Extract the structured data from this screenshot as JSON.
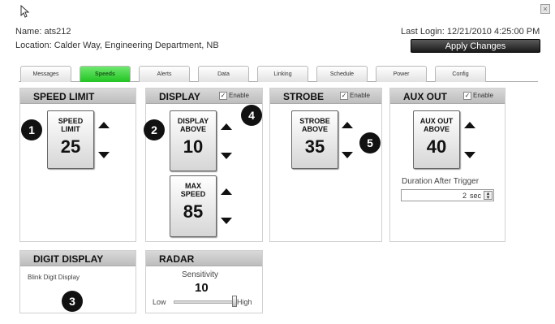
{
  "header": {
    "name_line": "Name:  ats212",
    "location_line": "Location:  Calder Way, Engineering Department, NB",
    "last_login": "Last Login: 12/21/2010 4:25:00 PM",
    "apply_button": "Apply Changes",
    "close_glyph": "×"
  },
  "tabs": [
    {
      "label": "Messages",
      "active": false
    },
    {
      "label": "Speeds",
      "active": true
    },
    {
      "label": "Alerts",
      "active": false
    },
    {
      "label": "Data",
      "active": false
    },
    {
      "label": "Linking",
      "active": false
    },
    {
      "label": "Schedule",
      "active": false
    },
    {
      "label": "Power",
      "active": false
    },
    {
      "label": "Config",
      "active": false
    }
  ],
  "speed_limit": {
    "title": "SPEED LIMIT",
    "box_label": "SPEED\nLIMIT",
    "value": "25",
    "badge": "1"
  },
  "display": {
    "title": "DISPLAY",
    "enable_label": "Enable",
    "enable_checked": true,
    "above_label": "DISPLAY\nABOVE",
    "above_value": "10",
    "max_label": "MAX\nSPEED",
    "max_value": "85",
    "badge_left": "2",
    "badge_enable": "4"
  },
  "strobe": {
    "title": "STROBE",
    "enable_label": "Enable",
    "enable_checked": true,
    "box_label": "STROBE\nABOVE",
    "value": "35",
    "badge": "5"
  },
  "aux_out": {
    "title": "AUX OUT",
    "enable_label": "Enable",
    "enable_checked": true,
    "box_label": "AUX OUT\nABOVE",
    "value": "40",
    "duration_label": "Duration After Trigger",
    "duration_value": "2",
    "duration_unit": "sec"
  },
  "digit_display": {
    "title": "DIGIT DISPLAY",
    "blink_label": "Blink Digit Display",
    "badge": "3"
  },
  "radar": {
    "title": "RADAR",
    "sensitivity_label": "Sensitivity",
    "sensitivity_value": "10",
    "low_label": "Low",
    "high_label": "High"
  },
  "colors": {
    "active_tab": "#22c322",
    "panel_header": "#c9c9c9",
    "badge": "#111111"
  },
  "icons": [
    "cursor-icon",
    "close-icon",
    "checkbox-icon",
    "up-arrow-icon",
    "down-arrow-icon",
    "spin-icon"
  ]
}
